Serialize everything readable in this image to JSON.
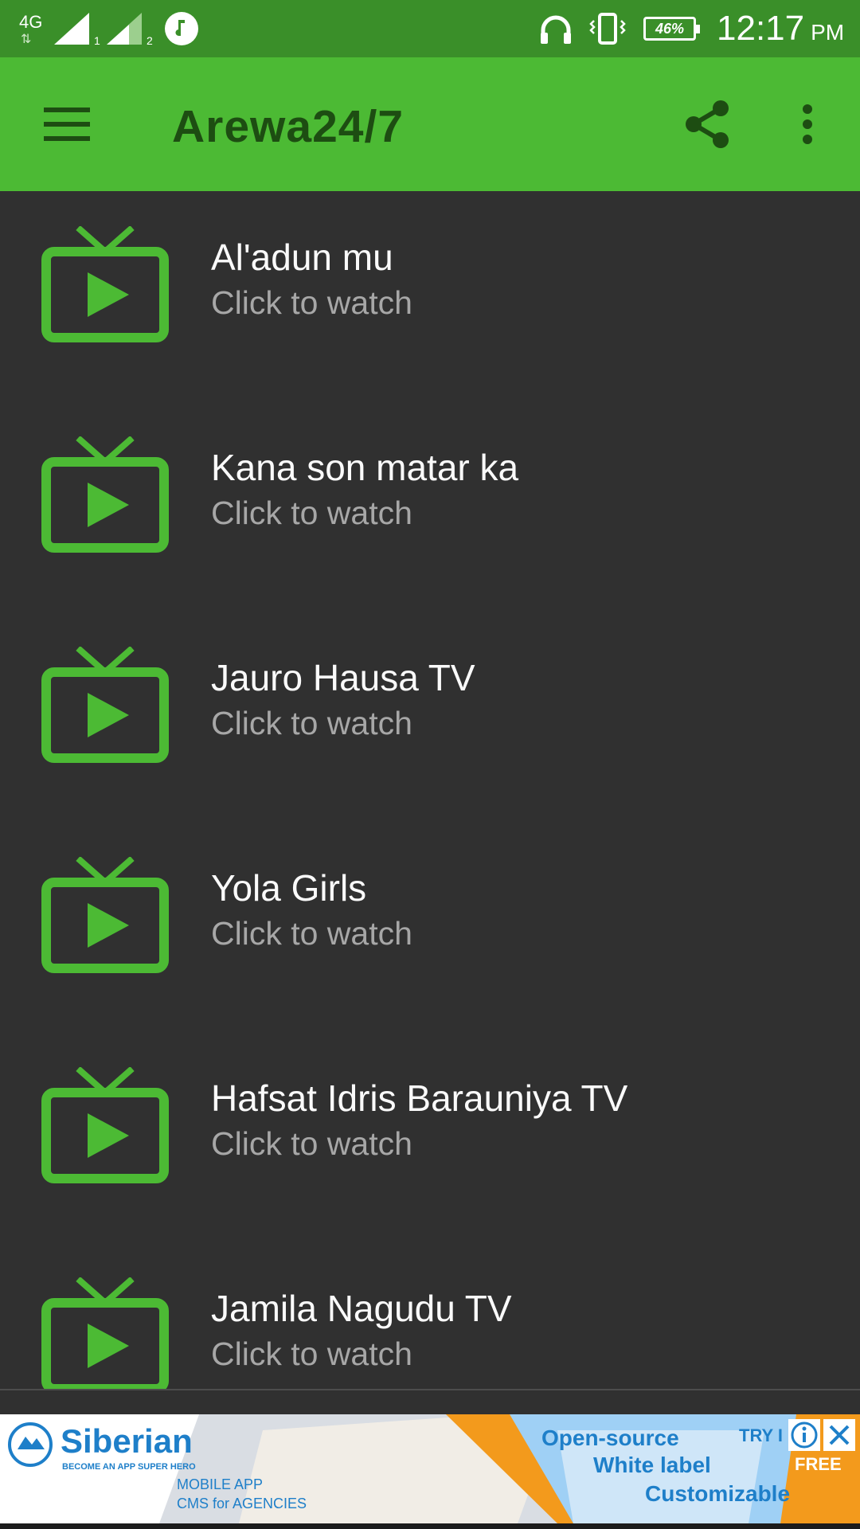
{
  "status_bar": {
    "network": "4G",
    "sim1": "1",
    "sim2": "2",
    "battery": "46%",
    "time": "12:17",
    "ampm": "PM"
  },
  "toolbar": {
    "title": "Arewa24/7",
    "color": "#4cba34"
  },
  "channels": [
    {
      "name": "Al'adun mu",
      "subtitle": "Click to watch"
    },
    {
      "name": "Kana son matar ka",
      "subtitle": "Click to watch"
    },
    {
      "name": "Jauro Hausa TV",
      "subtitle": "Click to watch"
    },
    {
      "name": "Yola Girls",
      "subtitle": "Click to watch"
    },
    {
      "name": "Hafsat Idris Barauniya TV",
      "subtitle": "Click to watch"
    },
    {
      "name": "Jamila Nagudu TV",
      "subtitle": "Click to watch"
    }
  ],
  "ad": {
    "brand": "Siberian",
    "tagline": "BECOME AN APP SUPER HERO",
    "line1": "MOBILE APP",
    "line2": "CMS for AGENCIES",
    "feature1": "Open-source",
    "feature2": "White label",
    "feature3": "Customizable",
    "try": "TRY I",
    "free": "FREE"
  },
  "colors": {
    "accent": "#4cba34",
    "status_bar": "#3a8f29",
    "background": "#303030",
    "ad_orange": "#f39a1c",
    "ad_blue": "#1e7fc9"
  }
}
